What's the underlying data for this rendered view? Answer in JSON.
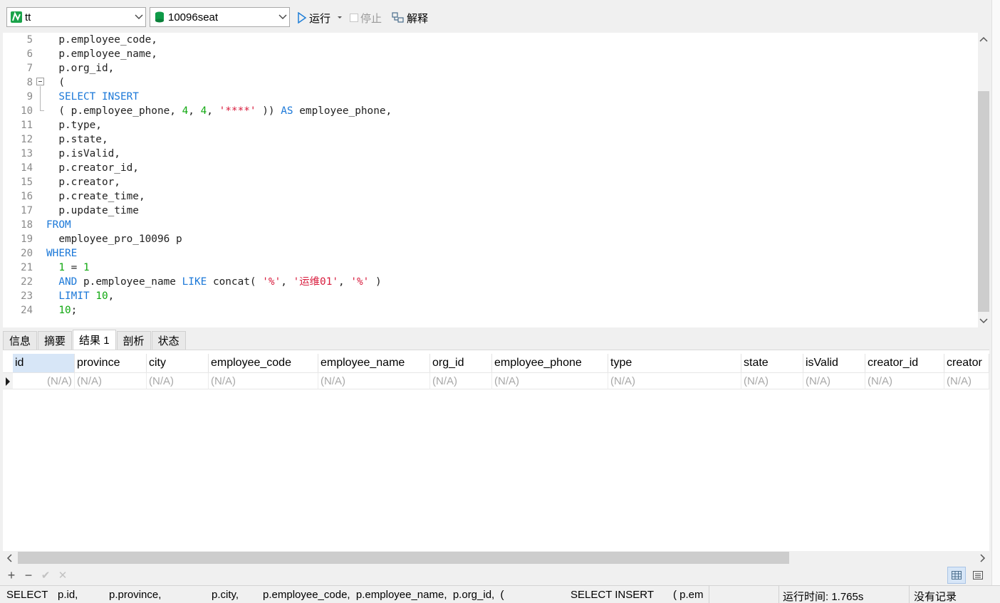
{
  "toolbar": {
    "connection": "tt",
    "database": "10096seat",
    "run_label": "运行",
    "stop_label": "停止",
    "explain_label": "解释",
    "connection_icon_color": "#1aa34a",
    "database_icon_color": "#0e9a47",
    "run_icon_color": "#1f7fd8"
  },
  "editor": {
    "line_numbers": [
      "5",
      "6",
      "7",
      "8",
      "9",
      "10",
      "11",
      "12",
      "13",
      "14",
      "15",
      "16",
      "17",
      "18",
      "19",
      "20",
      "21",
      "22",
      "23",
      "24"
    ],
    "lines": [
      [
        {
          "t": "  p.employee_code,",
          "c": ""
        }
      ],
      [
        {
          "t": "  p.employee_name,",
          "c": ""
        }
      ],
      [
        {
          "t": "  p.org_id,",
          "c": ""
        }
      ],
      [
        {
          "t": "  (",
          "c": ""
        }
      ],
      [
        {
          "t": "  ",
          "c": ""
        },
        {
          "t": "SELECT INSERT",
          "c": "kw"
        }
      ],
      [
        {
          "t": "  ( p.employee_phone, ",
          "c": ""
        },
        {
          "t": "4",
          "c": "num"
        },
        {
          "t": ", ",
          "c": ""
        },
        {
          "t": "4",
          "c": "num"
        },
        {
          "t": ", ",
          "c": ""
        },
        {
          "t": "'****'",
          "c": "str"
        },
        {
          "t": " )) ",
          "c": ""
        },
        {
          "t": "AS",
          "c": "kw"
        },
        {
          "t": " employee_phone,",
          "c": ""
        }
      ],
      [
        {
          "t": "  p.type,",
          "c": ""
        }
      ],
      [
        {
          "t": "  p.state,",
          "c": ""
        }
      ],
      [
        {
          "t": "  p.isValid,",
          "c": ""
        }
      ],
      [
        {
          "t": "  p.creator_id,",
          "c": ""
        }
      ],
      [
        {
          "t": "  p.creator,",
          "c": ""
        }
      ],
      [
        {
          "t": "  p.create_time,",
          "c": ""
        }
      ],
      [
        {
          "t": "  p.update_time",
          "c": ""
        }
      ],
      [
        {
          "t": "FROM",
          "c": "kw"
        }
      ],
      [
        {
          "t": "  employee_pro_10096 p",
          "c": ""
        }
      ],
      [
        {
          "t": "WHERE",
          "c": "kw"
        }
      ],
      [
        {
          "t": "  ",
          "c": ""
        },
        {
          "t": "1",
          "c": "num"
        },
        {
          "t": " = ",
          "c": ""
        },
        {
          "t": "1",
          "c": "num"
        }
      ],
      [
        {
          "t": "  ",
          "c": ""
        },
        {
          "t": "AND",
          "c": "kw"
        },
        {
          "t": " p.employee_name ",
          "c": ""
        },
        {
          "t": "LIKE",
          "c": "kw"
        },
        {
          "t": " concat( ",
          "c": ""
        },
        {
          "t": "'%'",
          "c": "str"
        },
        {
          "t": ", ",
          "c": ""
        },
        {
          "t": "'运维01'",
          "c": "str"
        },
        {
          "t": ", ",
          "c": ""
        },
        {
          "t": "'%'",
          "c": "str"
        },
        {
          "t": " )",
          "c": ""
        }
      ],
      [
        {
          "t": "  ",
          "c": ""
        },
        {
          "t": "LIMIT",
          "c": "kw"
        },
        {
          "t": " ",
          "c": ""
        },
        {
          "t": "10",
          "c": "num"
        },
        {
          "t": ",",
          "c": ""
        }
      ],
      [
        {
          "t": "  ",
          "c": ""
        },
        {
          "t": "10",
          "c": "num"
        },
        {
          "t": ";",
          "c": ""
        }
      ]
    ]
  },
  "tabs": [
    "信息",
    "摘要",
    "结果 1",
    "剖析",
    "状态"
  ],
  "active_tab": "结果 1",
  "grid": {
    "columns": [
      "id",
      "province",
      "city",
      "employee_code",
      "employee_name",
      "org_id",
      "employee_phone",
      "type",
      "state",
      "isValid",
      "creator_id",
      "creator"
    ],
    "row": [
      "(N/A)",
      "(N/A)",
      "(N/A)",
      "(N/A)",
      "(N/A)",
      "(N/A)",
      "(N/A)",
      "(N/A)",
      "(N/A)",
      "(N/A)",
      "(N/A)",
      "(N/A)"
    ]
  },
  "status": {
    "sql_parts": [
      "SELECT",
      "p.id,",
      "p.province,",
      "p.city,",
      "p.employee_code,  p.employee_name,  p.org_id,  (",
      "SELECT INSERT",
      "( p.em"
    ],
    "run_time": "运行时间: 1.765s",
    "records": "没有记录"
  }
}
